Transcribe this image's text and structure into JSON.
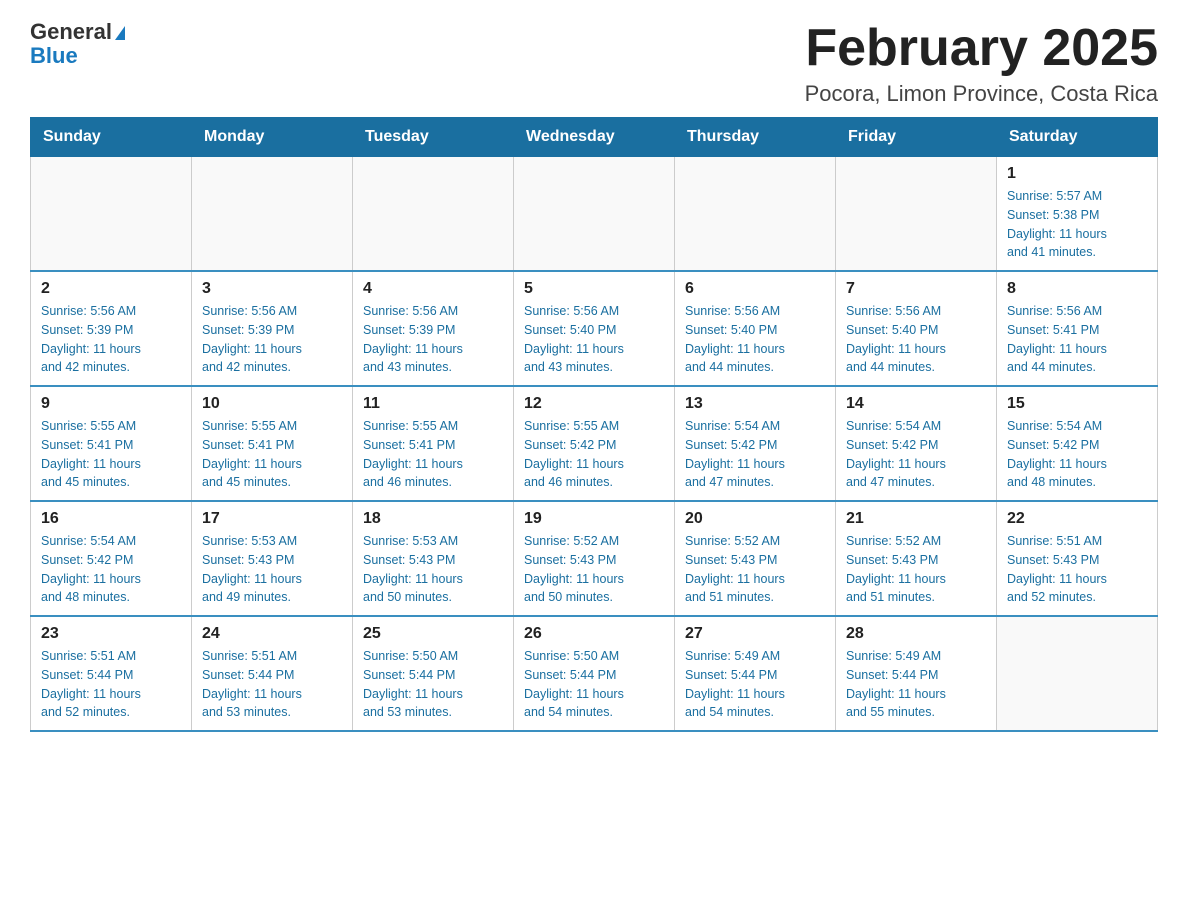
{
  "header": {
    "logo_general": "General",
    "logo_blue": "Blue",
    "title": "February 2025",
    "subtitle": "Pocora, Limon Province, Costa Rica"
  },
  "calendar": {
    "days_of_week": [
      "Sunday",
      "Monday",
      "Tuesday",
      "Wednesday",
      "Thursday",
      "Friday",
      "Saturday"
    ],
    "weeks": [
      [
        {
          "day": "",
          "info": ""
        },
        {
          "day": "",
          "info": ""
        },
        {
          "day": "",
          "info": ""
        },
        {
          "day": "",
          "info": ""
        },
        {
          "day": "",
          "info": ""
        },
        {
          "day": "",
          "info": ""
        },
        {
          "day": "1",
          "info": "Sunrise: 5:57 AM\nSunset: 5:38 PM\nDaylight: 11 hours\nand 41 minutes."
        }
      ],
      [
        {
          "day": "2",
          "info": "Sunrise: 5:56 AM\nSunset: 5:39 PM\nDaylight: 11 hours\nand 42 minutes."
        },
        {
          "day": "3",
          "info": "Sunrise: 5:56 AM\nSunset: 5:39 PM\nDaylight: 11 hours\nand 42 minutes."
        },
        {
          "day": "4",
          "info": "Sunrise: 5:56 AM\nSunset: 5:39 PM\nDaylight: 11 hours\nand 43 minutes."
        },
        {
          "day": "5",
          "info": "Sunrise: 5:56 AM\nSunset: 5:40 PM\nDaylight: 11 hours\nand 43 minutes."
        },
        {
          "day": "6",
          "info": "Sunrise: 5:56 AM\nSunset: 5:40 PM\nDaylight: 11 hours\nand 44 minutes."
        },
        {
          "day": "7",
          "info": "Sunrise: 5:56 AM\nSunset: 5:40 PM\nDaylight: 11 hours\nand 44 minutes."
        },
        {
          "day": "8",
          "info": "Sunrise: 5:56 AM\nSunset: 5:41 PM\nDaylight: 11 hours\nand 44 minutes."
        }
      ],
      [
        {
          "day": "9",
          "info": "Sunrise: 5:55 AM\nSunset: 5:41 PM\nDaylight: 11 hours\nand 45 minutes."
        },
        {
          "day": "10",
          "info": "Sunrise: 5:55 AM\nSunset: 5:41 PM\nDaylight: 11 hours\nand 45 minutes."
        },
        {
          "day": "11",
          "info": "Sunrise: 5:55 AM\nSunset: 5:41 PM\nDaylight: 11 hours\nand 46 minutes."
        },
        {
          "day": "12",
          "info": "Sunrise: 5:55 AM\nSunset: 5:42 PM\nDaylight: 11 hours\nand 46 minutes."
        },
        {
          "day": "13",
          "info": "Sunrise: 5:54 AM\nSunset: 5:42 PM\nDaylight: 11 hours\nand 47 minutes."
        },
        {
          "day": "14",
          "info": "Sunrise: 5:54 AM\nSunset: 5:42 PM\nDaylight: 11 hours\nand 47 minutes."
        },
        {
          "day": "15",
          "info": "Sunrise: 5:54 AM\nSunset: 5:42 PM\nDaylight: 11 hours\nand 48 minutes."
        }
      ],
      [
        {
          "day": "16",
          "info": "Sunrise: 5:54 AM\nSunset: 5:42 PM\nDaylight: 11 hours\nand 48 minutes."
        },
        {
          "day": "17",
          "info": "Sunrise: 5:53 AM\nSunset: 5:43 PM\nDaylight: 11 hours\nand 49 minutes."
        },
        {
          "day": "18",
          "info": "Sunrise: 5:53 AM\nSunset: 5:43 PM\nDaylight: 11 hours\nand 50 minutes."
        },
        {
          "day": "19",
          "info": "Sunrise: 5:52 AM\nSunset: 5:43 PM\nDaylight: 11 hours\nand 50 minutes."
        },
        {
          "day": "20",
          "info": "Sunrise: 5:52 AM\nSunset: 5:43 PM\nDaylight: 11 hours\nand 51 minutes."
        },
        {
          "day": "21",
          "info": "Sunrise: 5:52 AM\nSunset: 5:43 PM\nDaylight: 11 hours\nand 51 minutes."
        },
        {
          "day": "22",
          "info": "Sunrise: 5:51 AM\nSunset: 5:43 PM\nDaylight: 11 hours\nand 52 minutes."
        }
      ],
      [
        {
          "day": "23",
          "info": "Sunrise: 5:51 AM\nSunset: 5:44 PM\nDaylight: 11 hours\nand 52 minutes."
        },
        {
          "day": "24",
          "info": "Sunrise: 5:51 AM\nSunset: 5:44 PM\nDaylight: 11 hours\nand 53 minutes."
        },
        {
          "day": "25",
          "info": "Sunrise: 5:50 AM\nSunset: 5:44 PM\nDaylight: 11 hours\nand 53 minutes."
        },
        {
          "day": "26",
          "info": "Sunrise: 5:50 AM\nSunset: 5:44 PM\nDaylight: 11 hours\nand 54 minutes."
        },
        {
          "day": "27",
          "info": "Sunrise: 5:49 AM\nSunset: 5:44 PM\nDaylight: 11 hours\nand 54 minutes."
        },
        {
          "day": "28",
          "info": "Sunrise: 5:49 AM\nSunset: 5:44 PM\nDaylight: 11 hours\nand 55 minutes."
        },
        {
          "day": "",
          "info": ""
        }
      ]
    ]
  }
}
